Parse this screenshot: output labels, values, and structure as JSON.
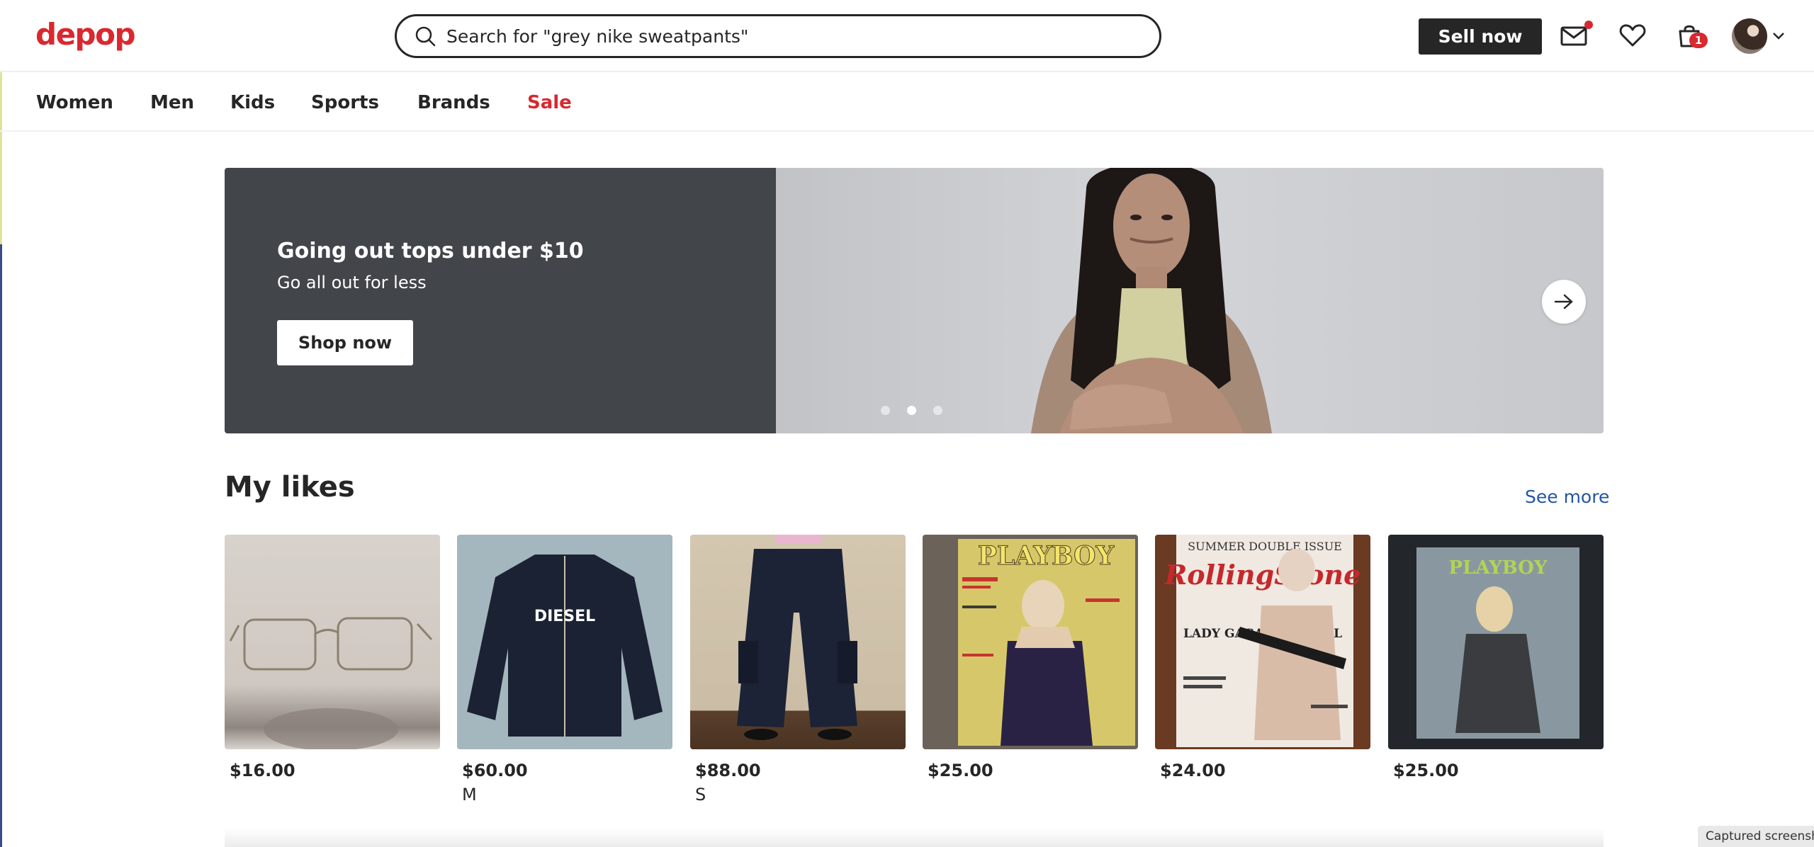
{
  "header": {
    "logo": "depop",
    "search_value": "Search for \"grey nike sweatpants\"",
    "sell_label": "Sell now",
    "cart_count": "1",
    "icons": [
      "search-icon",
      "mail-icon",
      "heart-icon",
      "cart-icon",
      "avatar",
      "chevron-down-icon"
    ]
  },
  "nav": {
    "items": [
      "Women",
      "Men",
      "Kids",
      "Sports",
      "Brands",
      "Sale"
    ]
  },
  "hero": {
    "title": "Going out tops under $10",
    "subtitle": "Go all out for less",
    "button": "Shop now",
    "slides": 3,
    "active_slide": 2
  },
  "likes": {
    "title": "My likes",
    "see_more": "See more",
    "items": [
      {
        "price": "$16.00",
        "size": ""
      },
      {
        "price": "$60.00",
        "size": "M"
      },
      {
        "price": "$88.00",
        "size": "S"
      },
      {
        "price": "$25.00",
        "size": ""
      },
      {
        "price": "$24.00",
        "size": ""
      },
      {
        "price": "$25.00",
        "size": ""
      }
    ],
    "thumb_text": {
      "diesel": "DIESEL",
      "playboy": "PLAYBOY",
      "rolling_top": "SUMMER DOUBLE ISSUE",
      "rolling_logo": "RollingStone",
      "rolling_cover": "LADY GAGA TELLS ALL"
    }
  },
  "status": {
    "captured": "Captured screensh"
  },
  "colors": {
    "brand": "#d9282f",
    "dark": "#262626",
    "link": "#2455a6",
    "hero_panel": "#424549"
  }
}
